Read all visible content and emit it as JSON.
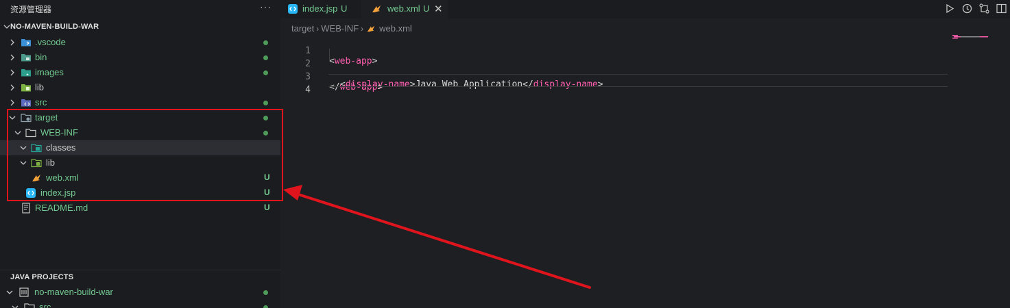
{
  "sidebar": {
    "title": "资源管理器",
    "more_label": "···",
    "workspace": "NO-MAVEN-BUILD-WAR",
    "items": [
      {
        "name": ".vscode",
        "icon": "vscode-folder-icon",
        "status": "dot"
      },
      {
        "name": "bin",
        "icon": "bin-folder-icon",
        "status": "dot"
      },
      {
        "name": "images",
        "icon": "images-folder-icon",
        "status": "dot"
      },
      {
        "name": "lib",
        "icon": "lib-folder-icon",
        "status": ""
      },
      {
        "name": "src",
        "icon": "src-folder-icon",
        "status": "dot"
      },
      {
        "name": "target",
        "icon": "target-folder-icon",
        "status": "dot"
      },
      {
        "name": "WEB-INF",
        "icon": "folder-icon",
        "status": "dot"
      },
      {
        "name": "classes",
        "icon": "classes-folder-icon",
        "status": ""
      },
      {
        "name": "lib",
        "icon": "lib-folder-icon",
        "status": ""
      },
      {
        "name": "web.xml",
        "icon": "xml-file-icon",
        "status": "U"
      },
      {
        "name": "index.jsp",
        "icon": "jsp-file-icon",
        "status": "U"
      },
      {
        "name": "README.md",
        "icon": "markdown-file-icon",
        "status": "U"
      }
    ],
    "java_projects": {
      "title": "JAVA PROJECTS",
      "project": "no-maven-build-war",
      "child": "src"
    }
  },
  "tabs": [
    {
      "label": "index.jsp",
      "badge": "U",
      "icon": "jsp-file-icon",
      "active": false
    },
    {
      "label": "web.xml",
      "badge": "U",
      "icon": "xml-file-icon",
      "active": true,
      "close": "✕"
    }
  ],
  "breadcrumb": {
    "parts": [
      "target",
      "WEB-INF",
      "web.xml"
    ],
    "separator": "›"
  },
  "code": {
    "line_numbers": [
      "1",
      "2",
      "3",
      "4"
    ],
    "lines": [
      {
        "open": "<",
        "tag": "web-app",
        "close": ">"
      },
      {
        "open": "<",
        "tag": "display-name",
        "mid": ">",
        "text": "Java Web Application",
        "open2": "</",
        "tag2": "display-name",
        "close": ">"
      },
      {
        "open": "</",
        "tag": "web-app",
        "close": ">"
      },
      {}
    ]
  },
  "colors": {
    "accent_green": "#73c991",
    "tag_pink": "#ff5fb0",
    "annotation_red": "#e0141c"
  }
}
